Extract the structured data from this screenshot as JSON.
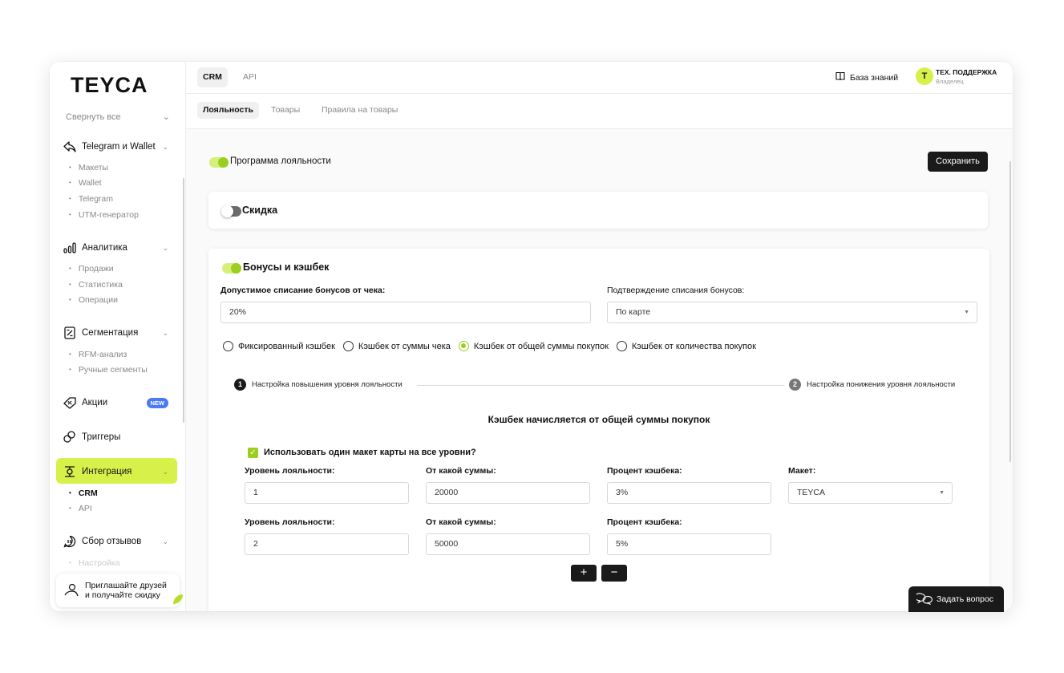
{
  "brand": {
    "logo": "TEYCA",
    "accent": "#d8f14a"
  },
  "sidebar": {
    "collapse_label": "Свернуть все",
    "sections": [
      {
        "label": "Telegram и Wallet",
        "icon": "share-icon",
        "items": [
          "Макеты",
          "Wallet",
          "Telegram",
          "UTM-генератор"
        ]
      },
      {
        "label": "Аналитика",
        "icon": "chart-icon",
        "items": [
          "Продажи",
          "Статистика",
          "Операции"
        ]
      },
      {
        "label": "Сегментация",
        "icon": "segment-icon",
        "items": [
          "RFM-анализ",
          "Ручные сегменты"
        ]
      },
      {
        "label": "Акции",
        "icon": "promo-icon",
        "badge": "NEW"
      },
      {
        "label": "Триггеры",
        "icon": "trigger-icon"
      },
      {
        "label": "Интеграция",
        "icon": "integration-icon",
        "items": [
          "CRM",
          "API"
        ],
        "active_item": "CRM"
      },
      {
        "label": "Сбор отзывов",
        "icon": "feedback-icon",
        "items": [
          "Настройка"
        ]
      }
    ],
    "invite": {
      "line1": "Приглашайте друзей",
      "line2": "и получайте скидку"
    }
  },
  "topbar": {
    "tabs": [
      "CRM",
      "API"
    ],
    "active_tab": "CRM",
    "knowledge_base": "База знаний",
    "user": {
      "initial": "T",
      "name": "ТЕХ. ПОДДЕРЖКА",
      "role": "Владелец"
    }
  },
  "subtabs": {
    "items": [
      "Лояльность",
      "Товары",
      "Правила на товары"
    ],
    "active": "Лояльность"
  },
  "loyalty": {
    "program_label": "Программа лояльности",
    "program_on": true,
    "save_label": "Сохранить",
    "discount": {
      "label": "Скидка",
      "on": false
    },
    "bonus": {
      "label": "Бонусы и кэшбек",
      "on": true,
      "writeoff_label": "Допустимое списание бонусов от чека:",
      "writeoff_value": "20%",
      "confirm_label": "Подтверждение списания бонусов:",
      "confirm_value": "По карте",
      "cashback_types": [
        "Фиксированный кэшбек",
        "Кэшбек от суммы чека",
        "Кэшбек от общей суммы покупок",
        "Кэшбек от количества покупок"
      ],
      "cashback_selected": "Кэшбек от общей суммы покупок",
      "steps": [
        {
          "num": "1",
          "label": "Настройка повышения уровня лояльности"
        },
        {
          "num": "2",
          "label": "Настройка понижения уровня лояльности"
        }
      ],
      "section_title": "Кэшбек начисляется от общей суммы покупок",
      "same_layout_label": "Использовать один макет карты на все уровни?",
      "col_level": "Уровень лояльности:",
      "col_amount": "От какой суммы:",
      "col_percent": "Процент кэшбека:",
      "col_layout": "Макет:",
      "levels": [
        {
          "level": "1",
          "amount": "20000",
          "percent": "3%",
          "layout": "TEYCA"
        },
        {
          "level": "2",
          "amount": "50000",
          "percent": "5%"
        }
      ]
    }
  },
  "ask_button": "Задать вопрос"
}
